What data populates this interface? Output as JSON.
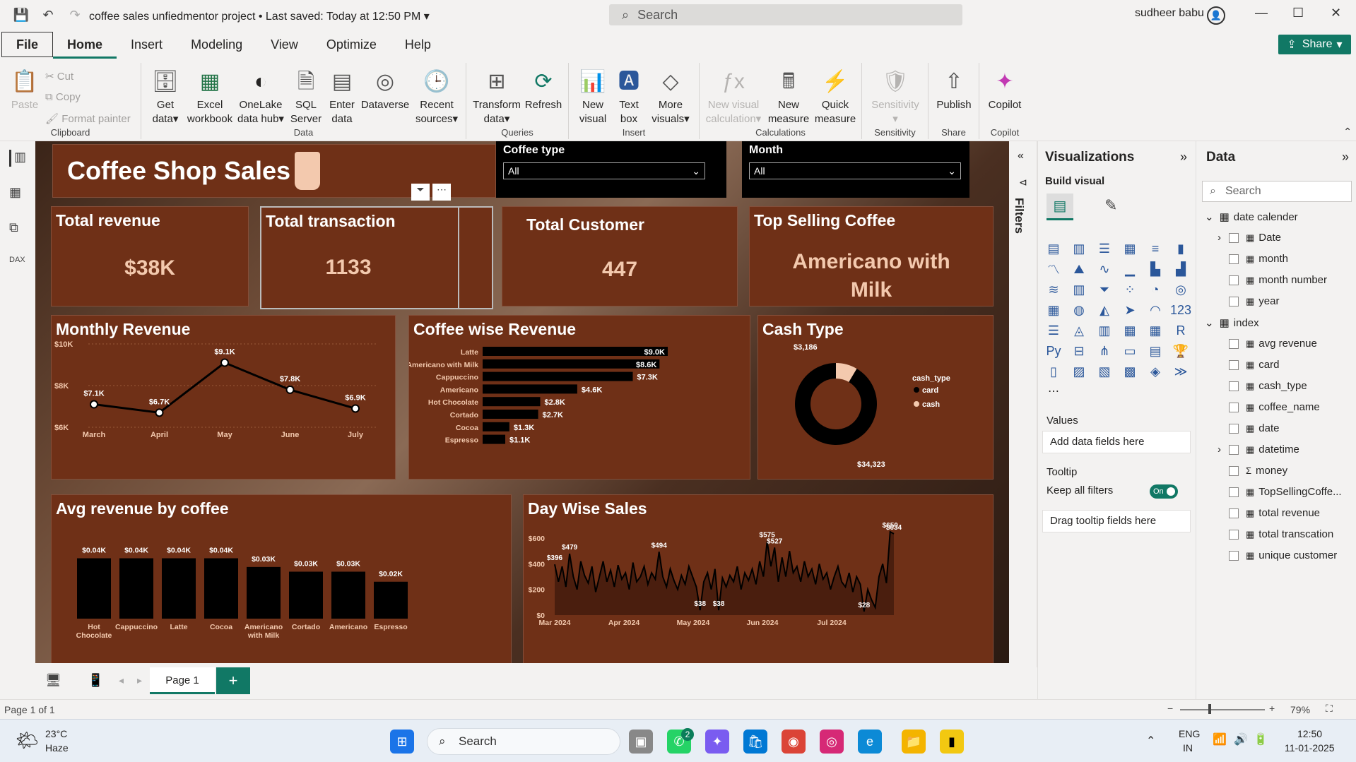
{
  "window": {
    "title": "coffee sales unfiedmentor project",
    "saved": "• Last saved: Today at 12:50 PM",
    "search_placeholder": "Search",
    "user": "sudheer babu"
  },
  "tabs": [
    "File",
    "Home",
    "Insert",
    "Modeling",
    "View",
    "Optimize",
    "Help"
  ],
  "share_label": "Share",
  "ribbon": {
    "clipboard": {
      "paste": "Paste",
      "cut": "Cut",
      "copy": "Copy",
      "format_painter": "Format painter",
      "label": "Clipboard"
    },
    "data": {
      "items": [
        [
          "Get",
          "data"
        ],
        [
          "Excel",
          "workbook"
        ],
        [
          "OneLake",
          "data hub"
        ],
        [
          "SQL",
          "Server"
        ],
        [
          "Enter",
          "data"
        ],
        [
          "Dataverse",
          ""
        ],
        [
          "Recent",
          "sources"
        ]
      ],
      "label": "Data"
    },
    "queries": {
      "items": [
        [
          "Transform",
          "data"
        ],
        [
          "Refresh",
          ""
        ]
      ],
      "label": "Queries"
    },
    "insert": {
      "items": [
        [
          "New",
          "visual"
        ],
        [
          "Text",
          "box"
        ],
        [
          "More",
          "visuals"
        ]
      ],
      "label": "Insert"
    },
    "calculations": {
      "items": [
        [
          "New visual",
          "calculation"
        ],
        [
          "New",
          "measure"
        ],
        [
          "Quick",
          "measure"
        ]
      ],
      "label": "Calculations"
    },
    "sensitivity": {
      "items": [
        [
          "Sensitivity",
          ""
        ]
      ],
      "label": "Sensitivity"
    },
    "share": {
      "items": [
        [
          "Publish",
          ""
        ]
      ],
      "label": "Share"
    },
    "copilot": {
      "items": [
        [
          "Copilot",
          ""
        ]
      ],
      "label": "Copilot"
    }
  },
  "report": {
    "title": "Coffee Shop Sales",
    "slicer_coffee": {
      "label": "Coffee type",
      "value": "All"
    },
    "slicer_month": {
      "label": "Month",
      "value": "All"
    },
    "kpis": [
      {
        "title": "Total revenue",
        "value": "$38K"
      },
      {
        "title": "Total transaction",
        "value": "1133"
      },
      {
        "title": "Total Customer",
        "value": "447"
      },
      {
        "title": "Top Selling Coffee",
        "value_line1": "Americano with",
        "value_line2": "Milk"
      }
    ],
    "monthly_title": "Monthly Revenue",
    "coffee_title": "Coffee wise Revenue",
    "cash_title": "Cash Type",
    "avg_title": "Avg revenue by coffee",
    "day_title": "Day Wise Sales"
  },
  "chart_data": [
    {
      "type": "line",
      "title": "Monthly Revenue",
      "categories": [
        "March",
        "April",
        "May",
        "June",
        "July"
      ],
      "values": [
        7.1,
        6.7,
        9.1,
        7.8,
        6.9
      ],
      "labels": [
        "$7.1K",
        "$6.7K",
        "$9.1K",
        "$7.8K",
        "$6.9K"
      ],
      "ylim": [
        6,
        10
      ],
      "yticks": [
        "$6K",
        "$8K",
        "$10K"
      ]
    },
    {
      "type": "bar",
      "title": "Coffee wise Revenue",
      "orientation": "horizontal",
      "categories": [
        "Latte",
        "Americano with Milk",
        "Cappuccino",
        "Americano",
        "Hot Chocolate",
        "Cortado",
        "Cocoa",
        "Espresso"
      ],
      "values": [
        9.0,
        8.6,
        7.3,
        4.6,
        2.8,
        2.7,
        1.3,
        1.1
      ],
      "labels": [
        "$9.0K",
        "$8.6K",
        "$7.3K",
        "$4.6K",
        "$2.8K",
        "$2.7K",
        "$1.3K",
        "$1.1K"
      ]
    },
    {
      "type": "pie",
      "title": "Cash Type",
      "legend_title": "cash_type",
      "categories": [
        "card",
        "cash"
      ],
      "values": [
        34323,
        3186
      ],
      "labels": [
        "$34,323",
        "$3,186"
      ],
      "colors": [
        "#000000",
        "#f3c9ae"
      ]
    },
    {
      "type": "bar",
      "title": "Avg revenue by coffee",
      "categories": [
        "Hot Chocolate",
        "Cappuccino",
        "Latte",
        "Cocoa",
        "Americano with Milk",
        "Cortado",
        "Americano",
        "Espresso"
      ],
      "values": [
        0.04,
        0.04,
        0.04,
        0.04,
        0.03,
        0.03,
        0.03,
        0.02
      ],
      "heights": [
        0.9,
        0.9,
        0.9,
        0.9,
        0.77,
        0.7,
        0.7,
        0.55
      ],
      "labels": [
        "$0.04K",
        "$0.04K",
        "$0.04K",
        "$0.04K",
        "$0.03K",
        "$0.03K",
        "$0.03K",
        "$0.02K"
      ]
    },
    {
      "type": "area",
      "title": "Day Wise Sales",
      "xticks": [
        "Mar 2024",
        "Apr 2024",
        "May 2024",
        "Jun 2024",
        "Jul 2024"
      ],
      "yticks": [
        "$0",
        "$200",
        "$400",
        "$600"
      ],
      "ylim": [
        0,
        650
      ],
      "values": [
        396,
        260,
        380,
        220,
        479,
        300,
        200,
        420,
        310,
        250,
        380,
        180,
        300,
        420,
        260,
        350,
        220,
        390,
        280,
        330,
        200,
        410,
        260,
        300,
        380,
        240,
        330,
        280,
        494,
        300,
        220,
        360,
        270,
        200,
        310,
        240,
        380,
        300,
        220,
        38,
        260,
        330,
        200,
        360,
        38,
        290,
        220,
        310,
        260,
        380,
        200,
        330,
        270,
        360,
        240,
        420,
        300,
        575,
        380,
        527,
        260,
        450,
        300,
        500,
        330,
        380,
        260,
        420,
        300,
        360,
        240,
        400,
        280,
        330,
        200,
        300,
        380,
        260,
        220,
        330,
        180,
        300,
        240,
        28,
        200,
        120,
        60,
        300,
        400,
        250,
        650,
        634
      ],
      "labels": [
        {
          "i": 0,
          "t": "$396"
        },
        {
          "i": 4,
          "t": "$479"
        },
        {
          "i": 28,
          "t": "$494"
        },
        {
          "i": 39,
          "t": "$38"
        },
        {
          "i": 44,
          "t": "$38"
        },
        {
          "i": 57,
          "t": "$575"
        },
        {
          "i": 59,
          "t": "$527"
        },
        {
          "i": 83,
          "t": "$28"
        },
        {
          "i": 90,
          "t": "$650"
        },
        {
          "i": 91,
          "t": "$634"
        }
      ]
    }
  ],
  "visualizations_pane": {
    "title": "Visualizations",
    "build": "Build visual",
    "values": "Values",
    "add_fields": "Add data fields here",
    "tooltip": "Tooltip",
    "keep_filters": "Keep all filters",
    "toggle": "On",
    "drag_tooltip": "Drag tooltip fields here"
  },
  "filters_label": "Filters",
  "data_pane": {
    "title": "Data",
    "search": "Search",
    "tables": [
      {
        "name": "date calender",
        "fields": [
          "Date",
          "month",
          "month number",
          "year"
        ]
      },
      {
        "name": "index",
        "fields": [
          "avg revenue",
          "card",
          "cash_type",
          "coffee_name",
          "date",
          "datetime",
          "money",
          "TopSellingCoffe...",
          "total revenue",
          "total transcation",
          "unique customer"
        ]
      }
    ]
  },
  "page_tab": "Page 1",
  "status": {
    "page": "Page 1 of 1",
    "zoom": "79%"
  },
  "taskbar": {
    "temp": "23°C",
    "weather": "Haze",
    "search": "Search",
    "lang1": "ENG",
    "lang2": "IN",
    "time": "12:50",
    "date": "11-01-2025",
    "badge": "2"
  }
}
